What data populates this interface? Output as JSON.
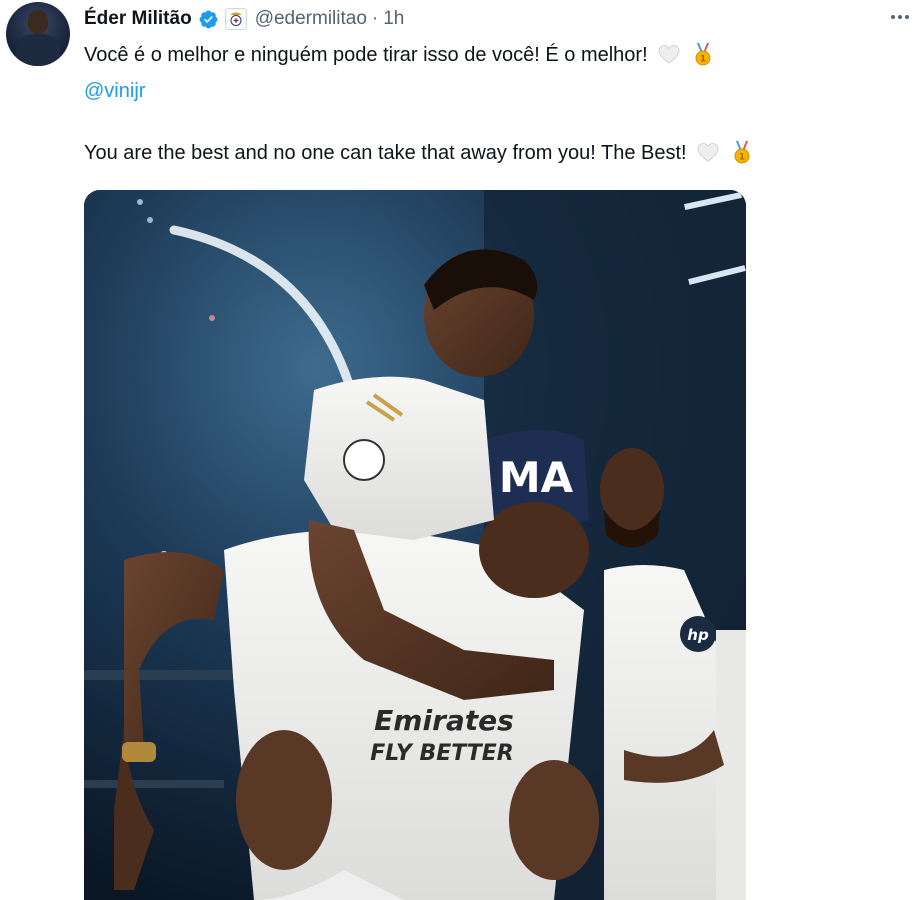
{
  "tweet": {
    "author": {
      "display_name": "Éder Militão",
      "handle": "@edermilitao",
      "verified": true,
      "affiliation_badge": "real-madrid-crest"
    },
    "separator": "·",
    "timestamp": "1h",
    "more_icon": "more-horizontal-icon",
    "text": {
      "portuguese": "Você é o melhor e ninguém pode tirar isso de você! É o melhor!",
      "mention": "@vinijr",
      "english": "You are the best and no one can take that away from you! The Best!",
      "emojis": [
        "white-heart",
        "gold-medal"
      ]
    },
    "media": {
      "type": "photo",
      "jersey_sponsor": "Emirates",
      "jersey_slogan": "FLY BETTER",
      "headband_text": "MA",
      "sleeve_badge": "hp"
    }
  },
  "colors": {
    "name_text": "#0f1419",
    "secondary_text": "#536471",
    "link": "#1d9bf0",
    "verified_badge": "#1d9bf0",
    "medal_gold": "#f4b400",
    "medal_ribbon": "#4a90d9"
  }
}
